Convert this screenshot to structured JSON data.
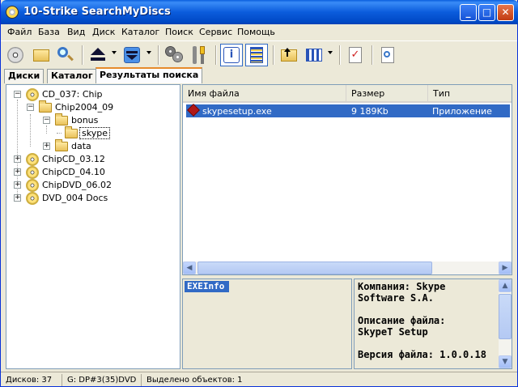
{
  "window": {
    "title": "10-Strike SearchMyDiscs"
  },
  "menu": [
    "Файл",
    "База",
    "Вид",
    "Диск",
    "Каталог",
    "Поиск",
    "Сервис",
    "Помощь"
  ],
  "toolbar": {
    "icons": [
      "disc-icon",
      "folder-icon",
      "search-icon",
      "eject-icon",
      "drive-icon",
      "discs-icon",
      "tools-icon",
      "info-icon",
      "list-icon",
      "up-folder-icon",
      "view-icon",
      "check-icon",
      "find-doc-icon"
    ]
  },
  "tabs": [
    {
      "label": "Диски",
      "active": false
    },
    {
      "label": "Каталог",
      "active": false
    },
    {
      "label": "Результаты поиска",
      "active": true
    }
  ],
  "tree": [
    {
      "label": "CD_037: Chip",
      "type": "disc",
      "expanded": true
    },
    {
      "label": "Chip2004_09",
      "type": "folder",
      "expanded": true
    },
    {
      "label": "bonus",
      "type": "folder",
      "expanded": true
    },
    {
      "label": "skype",
      "type": "folder",
      "selected": true
    },
    {
      "label": "data",
      "type": "folder",
      "expanded": false
    },
    {
      "label": "ChipCD_03.12",
      "type": "disc",
      "expanded": false
    },
    {
      "label": "ChipCD_04.10",
      "type": "disc",
      "expanded": false
    },
    {
      "label": "ChipDVD_06.02",
      "type": "disc",
      "expanded": false
    },
    {
      "label": "DVD_004 Docs",
      "type": "disc",
      "expanded": false
    }
  ],
  "file_list": {
    "columns": [
      "Имя файла",
      "Размер",
      "Тип"
    ],
    "rows": [
      {
        "name": "skypesetup.exe",
        "size": "9 189Kb",
        "type": "Приложение",
        "selected": true
      }
    ]
  },
  "exeinfo": {
    "title": "EXEInfo"
  },
  "info": {
    "company_label": "Компания: Skype",
    "company_cont": "Software S.A.",
    "desc_label": "Описание файла:",
    "desc_value": "SkypeT Setup",
    "version": "Версия файла: 1.0.0.18"
  },
  "status": {
    "discs": "Дисков: 37",
    "drive": "G: DP#3(35)DVD",
    "selected": "Выделено объектов: 1"
  },
  "colors": {
    "selection": "#316ac5",
    "titlebar": "#0b5cdc",
    "tab_accent": "#e68b2c"
  }
}
